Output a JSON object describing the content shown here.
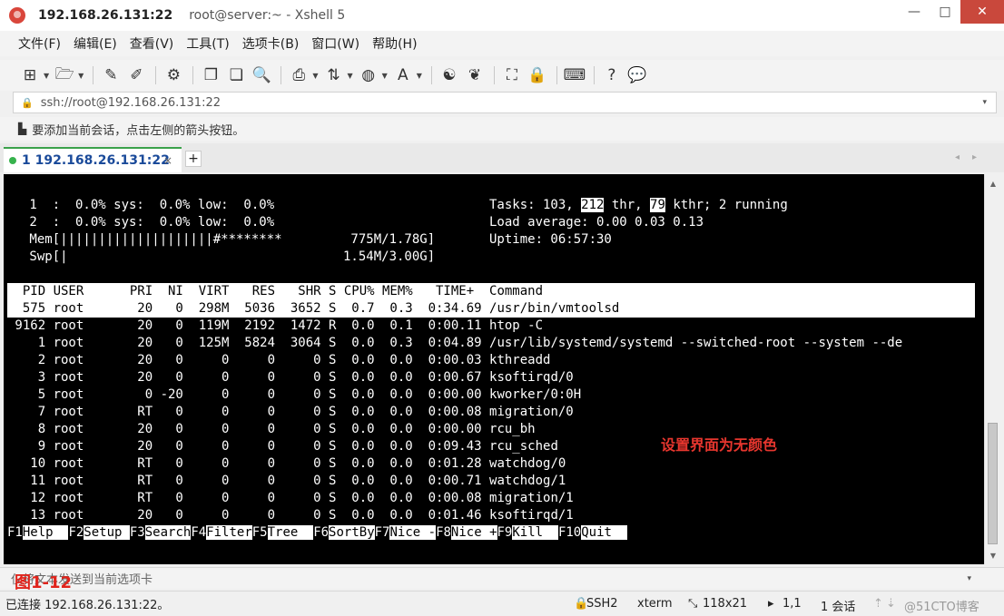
{
  "window": {
    "host": "192.168.26.131:22",
    "title_rest": "root@server:~ - Xshell 5",
    "minimize": "—",
    "maximize": "□",
    "close": "✕"
  },
  "menu": [
    "文件(F)",
    "编辑(E)",
    "查看(V)",
    "工具(T)",
    "选项卡(B)",
    "窗口(W)",
    "帮助(H)"
  ],
  "address": {
    "value": "ssh://root@192.168.26.131:22",
    "dropdown": "▾"
  },
  "info": "要添加当前会话，点击左侧的箭头按钮。",
  "tab": {
    "label": "1 192.168.26.131:22",
    "close": "×",
    "add": "+",
    "arrows": "◂▸"
  },
  "terminal": {
    "cpu1": " 1  :  0.0% sys:  0.0% low:  0.0%",
    "cpu2": " 2  :  0.0% sys:  0.0% low:  0.0%",
    "mem": " Mem[||||||||||||||||||||#********         775M/1.78G]",
    "swp": " Swp[|                                    1.54M/3.00G]",
    "tasks_prefix": "Tasks: 103, ",
    "tasks_thr": "212",
    "tasks_mid": " thr, ",
    "tasks_kthr": "79",
    "tasks_suffix": " kthr; 2 running",
    "load": "Load average: 0.00 0.03 0.13",
    "uptime": "Uptime: 06:57:30",
    "header": "  PID USER      PRI  NI  VIRT   RES   SHR S CPU% MEM%   TIME+  Command",
    "processes": [
      "  575 root       20   0  298M  5036  3652 S  0.7  0.3  0:34.69 /usr/bin/vmtoolsd",
      " 9162 root       20   0  119M  2192  1472 R  0.0  0.1  0:00.11 htop -C",
      "    1 root       20   0  125M  5824  3064 S  0.0  0.3  0:04.89 /usr/lib/systemd/systemd --switched-root --system --de",
      "    2 root       20   0     0     0     0 S  0.0  0.0  0:00.03 kthreadd",
      "    3 root       20   0     0     0     0 S  0.0  0.0  0:00.67 ksoftirqd/0",
      "    5 root        0 -20     0     0     0 S  0.0  0.0  0:00.00 kworker/0:0H",
      "    7 root       RT   0     0     0     0 S  0.0  0.0  0:00.08 migration/0",
      "    8 root       20   0     0     0     0 S  0.0  0.0  0:00.00 rcu_bh",
      "    9 root       20   0     0     0     0 S  0.0  0.0  0:09.43 rcu_sched",
      "   10 root       RT   0     0     0     0 S  0.0  0.0  0:01.28 watchdog/0",
      "   11 root       RT   0     0     0     0 S  0.0  0.0  0:00.71 watchdog/1",
      "   12 root       RT   0     0     0     0 S  0.0  0.0  0:00.08 migration/1",
      "   13 root       20   0     0     0     0 S  0.0  0.0  0:01.46 ksoftirqd/1"
    ],
    "fkeys": [
      {
        "key": "F1",
        "label": "Help  "
      },
      {
        "key": "F2",
        "label": "Setup "
      },
      {
        "key": "F3",
        "label": "Search"
      },
      {
        "key": "F4",
        "label": "Filter"
      },
      {
        "key": "F5",
        "label": "Tree  "
      },
      {
        "key": "F6",
        "label": "SortBy"
      },
      {
        "key": "F7",
        "label": "Nice -"
      },
      {
        "key": "F8",
        "label": "Nice +"
      },
      {
        "key": "F9",
        "label": "Kill  "
      },
      {
        "key": "F10",
        "label": "Quit  "
      }
    ]
  },
  "annotation": "设置界面为无颜色",
  "figure_label": "图1-12",
  "send_bar": "仅将文本发送到当前选项卡",
  "status": {
    "connected": "已连接 192.168.26.131:22。",
    "protocol": "SSH2",
    "term": "xterm",
    "size": "118x21",
    "cursor": "1,1",
    "sessions": "1 会话",
    "watermark": "@51CTO博客"
  },
  "colors": {
    "terminal_bg": "#000000",
    "terminal_fg": "#ffffff",
    "annotation": "#e7362e",
    "tab_accent": "#3aa14a",
    "close_button": "#c9483c"
  }
}
